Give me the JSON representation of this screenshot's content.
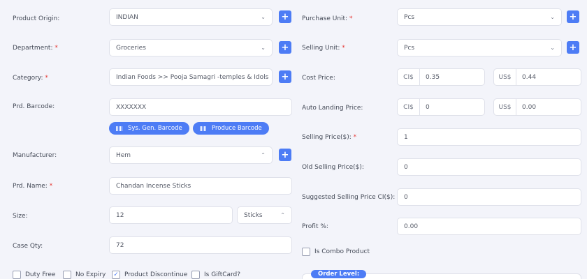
{
  "left": {
    "product_origin": {
      "label": "Product Origin:",
      "value": "INDIAN"
    },
    "department": {
      "label": "Department:",
      "value": "Groceries"
    },
    "category": {
      "label": "Category:",
      "value": "Indian Foods >> Pooja Samagri -temples & Idols"
    },
    "barcode": {
      "label": "Prd. Barcode:",
      "value": "XXXXXXX"
    },
    "sys_gen_barcode_label": "Sys. Gen. Barcode",
    "produce_barcode_label": "Produce Barcode",
    "manufacturer": {
      "label": "Manufacturer:",
      "value": "Hem"
    },
    "prd_name": {
      "label": "Prd. Name:",
      "value": "Chandan Incense Sticks"
    },
    "size": {
      "label": "Size:",
      "value": "12",
      "unit": "Sticks"
    },
    "case_qty": {
      "label": "Case Qty:",
      "value": "72"
    }
  },
  "right": {
    "purchase_unit": {
      "label": "Purchase Unit:",
      "value": "Pcs"
    },
    "selling_unit": {
      "label": "Selling Unit:",
      "value": "Pcs"
    },
    "cost_price": {
      "label": "Cost Price:",
      "cad_prefix": "CI$",
      "cad_value": "0.35",
      "usd_prefix": "US$",
      "usd_value": "0.44"
    },
    "auto_landing_price": {
      "label": "Auto Landing Price:",
      "cad_prefix": "CI$",
      "cad_value": "0",
      "usd_prefix": "US$",
      "usd_value": "0.00"
    },
    "selling_price": {
      "label": "Selling Price($):",
      "value": "1"
    },
    "old_selling_price": {
      "label": "Old Selling Price($):",
      "value": "0"
    },
    "suggested_selling_price": {
      "label": "Suggested Selling Price CI($):",
      "value": "0"
    },
    "profit": {
      "label": "Profit %:",
      "value": "0.00"
    },
    "is_combo_label": "Is Combo Product",
    "order_level_label": "Order Level:"
  },
  "required_mark": "*",
  "add_symbol": "+",
  "checkboxes": [
    {
      "label": "Duty Free",
      "checked": false
    },
    {
      "label": "No Expiry",
      "checked": false
    },
    {
      "label": "Product Discontinue",
      "checked": true
    },
    {
      "label": "Is GiftCard?",
      "checked": false
    }
  ],
  "colors": {
    "accent": "#4d7cf5",
    "required": "#e53935",
    "background": "#f3f4fa"
  },
  "icons": {
    "add": "plus-icon",
    "select": "chevron-icon",
    "barcode": "barcode-icon",
    "check": "check-icon"
  }
}
